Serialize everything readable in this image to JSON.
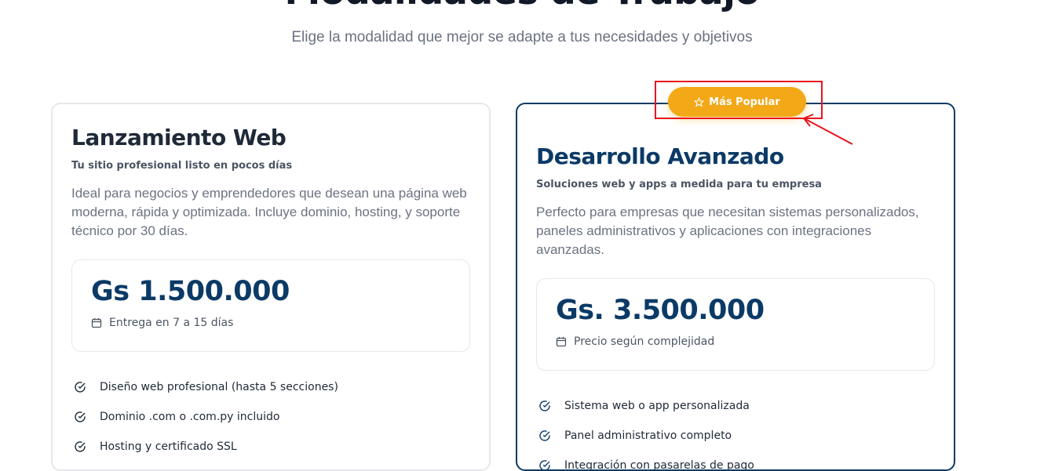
{
  "page": {
    "title": "Modalidades de Trabajo",
    "subtitle": "Elige la modalidad que mejor se adapte a tus necesidades y objetivos"
  },
  "plans": [
    {
      "title": "Lanzamiento Web",
      "tagline": "Tu sitio profesional listo en pocos días",
      "description": "Ideal para negocios y emprendedores que desean una página web moderna, rápida y optimizada. Incluye dominio, hosting, y soporte técnico por 30 días.",
      "price": "Gs 1.500.000",
      "price_note": "Entrega en 7 a 15 días",
      "price_note_icon": "calendar-icon",
      "features": [
        "Diseño web profesional (hasta 5 secciones)",
        "Dominio .com o .com.py incluido",
        "Hosting y certificado SSL"
      ],
      "feature_icon": "check-circle-icon"
    },
    {
      "badge": "Más Popular",
      "badge_icon": "star-icon",
      "title": "Desarrollo Avanzado",
      "tagline": "Soluciones web y apps a medida para tu empresa",
      "description": "Perfecto para empresas que necesitan sistemas personalizados, paneles administrativos y aplicaciones con integraciones avanzadas.",
      "price": "Gs. 3.500.000",
      "price_note": "Precio según complejidad",
      "price_note_icon": "calendar-icon",
      "features": [
        "Sistema web o app personalizada",
        "Panel administrativo completo",
        "Integración con pasarelas de pago"
      ],
      "feature_icon": "check-circle-icon"
    }
  ],
  "colors": {
    "primary": "#0b3a66",
    "accent": "#f2a817",
    "annotation": "#e8141c",
    "muted_text": "#6b7280",
    "border": "#e5e7eb"
  }
}
